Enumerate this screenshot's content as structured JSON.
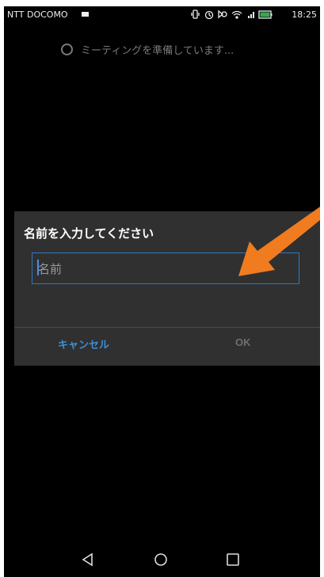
{
  "status_bar": {
    "carrier": "NTT DOCOMO",
    "time": "18:25"
  },
  "loading": {
    "text": "ミーティングを準備しています..."
  },
  "dialog": {
    "title": "名前を入力してください",
    "input_placeholder": "名前",
    "input_value": "",
    "cancel_label": "キャンセル",
    "ok_label": "OK"
  },
  "colors": {
    "accent": "#2f78c6",
    "annotation_arrow": "#f07c1f",
    "dialog_bg": "#303030",
    "screen_bg": "#000000"
  },
  "icons": {
    "status": [
      "video-icon",
      "vibrate-icon",
      "alarm-icon",
      "nfc-icon",
      "wifi-icon",
      "signal-icon",
      "battery-icon"
    ],
    "nav": [
      "back-icon",
      "home-icon",
      "recent-apps-icon"
    ],
    "annotation": "arrow-icon"
  }
}
